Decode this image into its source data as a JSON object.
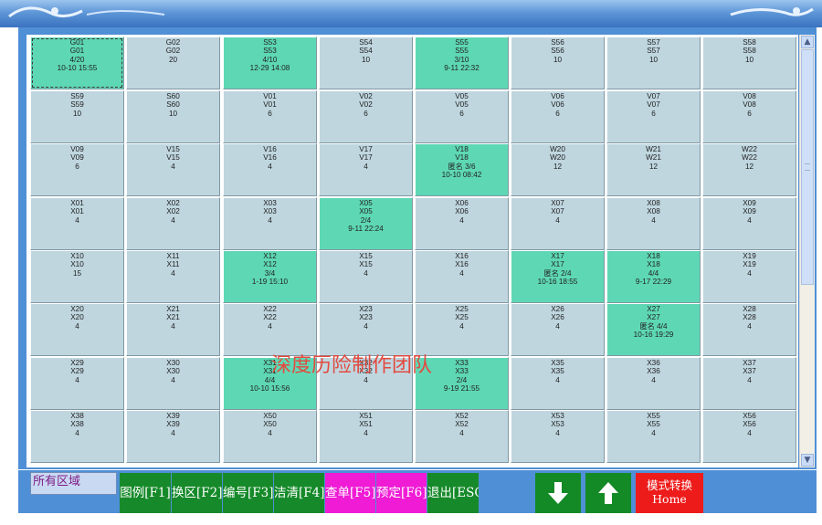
{
  "rooms": [
    {
      "code": "G01",
      "name": "G01",
      "detail": "4/20",
      "time": "10-10 15:55",
      "state": "occupied",
      "selected": true
    },
    {
      "code": "G02",
      "name": "G02",
      "detail": "20",
      "time": "",
      "state": "vacant"
    },
    {
      "code": "S53",
      "name": "S53",
      "detail": "4/10",
      "time": "12-29 14:08",
      "state": "occupied"
    },
    {
      "code": "S54",
      "name": "S54",
      "detail": "10",
      "time": "",
      "state": "vacant"
    },
    {
      "code": "S55",
      "name": "S55",
      "detail": "3/10",
      "time": "9-11 22:32",
      "state": "occupied"
    },
    {
      "code": "S56",
      "name": "S56",
      "detail": "10",
      "time": "",
      "state": "vacant"
    },
    {
      "code": "S57",
      "name": "S57",
      "detail": "10",
      "time": "",
      "state": "vacant"
    },
    {
      "code": "S58",
      "name": "S58",
      "detail": "10",
      "time": "",
      "state": "vacant"
    },
    {
      "code": "S59",
      "name": "S59",
      "detail": "10",
      "time": "",
      "state": "vacant"
    },
    {
      "code": "S60",
      "name": "S60",
      "detail": "10",
      "time": "",
      "state": "vacant"
    },
    {
      "code": "V01",
      "name": "V01",
      "detail": "6",
      "time": "",
      "state": "vacant"
    },
    {
      "code": "V02",
      "name": "V02",
      "detail": "6",
      "time": "",
      "state": "vacant"
    },
    {
      "code": "V05",
      "name": "V05",
      "detail": "6",
      "time": "",
      "state": "vacant"
    },
    {
      "code": "V06",
      "name": "V06",
      "detail": "6",
      "time": "",
      "state": "vacant"
    },
    {
      "code": "V07",
      "name": "V07",
      "detail": "6",
      "time": "",
      "state": "vacant"
    },
    {
      "code": "V08",
      "name": "V08",
      "detail": "6",
      "time": "",
      "state": "vacant"
    },
    {
      "code": "V09",
      "name": "V09",
      "detail": "6",
      "time": "",
      "state": "vacant"
    },
    {
      "code": "V15",
      "name": "V15",
      "detail": "4",
      "time": "",
      "state": "vacant"
    },
    {
      "code": "V16",
      "name": "V16",
      "detail": "4",
      "time": "",
      "state": "vacant"
    },
    {
      "code": "V17",
      "name": "V17",
      "detail": "4",
      "time": "",
      "state": "vacant"
    },
    {
      "code": "V18",
      "name": "V18",
      "detail": "匿名 3/6",
      "time": "10-10 08:42",
      "state": "occupied"
    },
    {
      "code": "W20",
      "name": "W20",
      "detail": "12",
      "time": "",
      "state": "vacant"
    },
    {
      "code": "W21",
      "name": "W21",
      "detail": "12",
      "time": "",
      "state": "vacant"
    },
    {
      "code": "W22",
      "name": "W22",
      "detail": "12",
      "time": "",
      "state": "vacant"
    },
    {
      "code": "X01",
      "name": "X01",
      "detail": "4",
      "time": "",
      "state": "vacant"
    },
    {
      "code": "X02",
      "name": "X02",
      "detail": "4",
      "time": "",
      "state": "vacant"
    },
    {
      "code": "X03",
      "name": "X03",
      "detail": "4",
      "time": "",
      "state": "vacant"
    },
    {
      "code": "X05",
      "name": "X05",
      "detail": "2/4",
      "time": "9-11 22:24",
      "state": "occupied"
    },
    {
      "code": "X06",
      "name": "X06",
      "detail": "4",
      "time": "",
      "state": "vacant"
    },
    {
      "code": "X07",
      "name": "X07",
      "detail": "4",
      "time": "",
      "state": "vacant"
    },
    {
      "code": "X08",
      "name": "X08",
      "detail": "4",
      "time": "",
      "state": "vacant"
    },
    {
      "code": "X09",
      "name": "X09",
      "detail": "4",
      "time": "",
      "state": "vacant"
    },
    {
      "code": "X10",
      "name": "X10",
      "detail": "15",
      "time": "",
      "state": "vacant"
    },
    {
      "code": "X11",
      "name": "X11",
      "detail": "4",
      "time": "",
      "state": "vacant"
    },
    {
      "code": "X12",
      "name": "X12",
      "detail": "3/4",
      "time": "1-19 15:10",
      "state": "occupied"
    },
    {
      "code": "X15",
      "name": "X15",
      "detail": "4",
      "time": "",
      "state": "vacant"
    },
    {
      "code": "X16",
      "name": "X16",
      "detail": "4",
      "time": "",
      "state": "vacant"
    },
    {
      "code": "X17",
      "name": "X17",
      "detail": "匿名 2/4",
      "time": "10-16 18:55",
      "state": "occupied"
    },
    {
      "code": "X18",
      "name": "X18",
      "detail": "4/4",
      "time": "9-17 22:29",
      "state": "occupied"
    },
    {
      "code": "X19",
      "name": "X19",
      "detail": "4",
      "time": "",
      "state": "vacant"
    },
    {
      "code": "X20",
      "name": "X20",
      "detail": "4",
      "time": "",
      "state": "vacant"
    },
    {
      "code": "X21",
      "name": "X21",
      "detail": "4",
      "time": "",
      "state": "vacant"
    },
    {
      "code": "X22",
      "name": "X22",
      "detail": "4",
      "time": "",
      "state": "vacant"
    },
    {
      "code": "X23",
      "name": "X23",
      "detail": "4",
      "time": "",
      "state": "vacant"
    },
    {
      "code": "X25",
      "name": "X25",
      "detail": "4",
      "time": "",
      "state": "vacant"
    },
    {
      "code": "X26",
      "name": "X26",
      "detail": "4",
      "time": "",
      "state": "vacant"
    },
    {
      "code": "X27",
      "name": "X27",
      "detail": "匿名 4/4",
      "time": "10-16 19:29",
      "state": "occupied"
    },
    {
      "code": "X28",
      "name": "X28",
      "detail": "4",
      "time": "",
      "state": "vacant"
    },
    {
      "code": "X29",
      "name": "X29",
      "detail": "4",
      "time": "",
      "state": "vacant"
    },
    {
      "code": "X30",
      "name": "X30",
      "detail": "4",
      "time": "",
      "state": "vacant"
    },
    {
      "code": "X31",
      "name": "X31",
      "detail": "4/4",
      "time": "10-10 15:56",
      "state": "occupied"
    },
    {
      "code": "X32",
      "name": "X32",
      "detail": "4",
      "time": "",
      "state": "vacant"
    },
    {
      "code": "X33",
      "name": "X33",
      "detail": "2/4",
      "time": "9-19 21:55",
      "state": "occupied"
    },
    {
      "code": "X35",
      "name": "X35",
      "detail": "4",
      "time": "",
      "state": "vacant"
    },
    {
      "code": "X36",
      "name": "X36",
      "detail": "4",
      "time": "",
      "state": "vacant"
    },
    {
      "code": "X37",
      "name": "X37",
      "detail": "4",
      "time": "",
      "state": "vacant"
    },
    {
      "code": "X38",
      "name": "X38",
      "detail": "4",
      "time": "",
      "state": "vacant"
    },
    {
      "code": "X39",
      "name": "X39",
      "detail": "4",
      "time": "",
      "state": "vacant"
    },
    {
      "code": "X50",
      "name": "X50",
      "detail": "4",
      "time": "",
      "state": "vacant"
    },
    {
      "code": "X51",
      "name": "X51",
      "detail": "4",
      "time": "",
      "state": "vacant"
    },
    {
      "code": "X52",
      "name": "X52",
      "detail": "4",
      "time": "",
      "state": "vacant"
    },
    {
      "code": "X53",
      "name": "X53",
      "detail": "4",
      "time": "",
      "state": "vacant"
    },
    {
      "code": "X55",
      "name": "X55",
      "detail": "4",
      "time": "",
      "state": "vacant"
    },
    {
      "code": "X56",
      "name": "X56",
      "detail": "4",
      "time": "",
      "state": "vacant"
    }
  ],
  "watermark": "深度历险制作团队",
  "toolbar": {
    "area_label": "所有区域",
    "legend": "图例[F1]",
    "switch_area": "换区[F2]",
    "number": "编号[F3]",
    "clean": "洁清[F4]",
    "query": "查单[F5]",
    "reserve": "预定[F6]",
    "exit": "退出[ESC]",
    "down_icon": "arrow-down-icon",
    "up_icon": "arrow-up-icon",
    "mode_label": "模式转换",
    "mode_key": "Home"
  },
  "colors": {
    "occupied": "#5ed8b4",
    "vacant": "#bfd6df",
    "toolbar_green": "#168a2a",
    "toolbar_magenta": "#ef1bd5",
    "mode_red": "#ee1b1b",
    "frame_blue": "#4f8fd6"
  }
}
